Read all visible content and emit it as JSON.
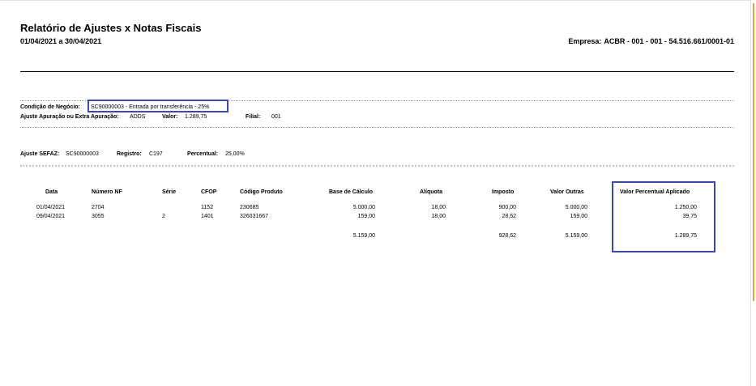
{
  "report": {
    "title": "Relatório de Ajustes x Notas Fiscais",
    "period": "01/04/2021 a 30/04/2021",
    "company_label": "Empresa:",
    "company_value": "ACBR - 001 - 001 - 54.516.661/0001-01"
  },
  "condition": {
    "label": "Condição de Negócio:",
    "value": "SC90000003 - Entrada por transferência -  25%"
  },
  "adjustment": {
    "type_label": "Ajuste Apuração ou Extra Apuração:",
    "type_value": "ADDS",
    "amount_label": "Valor:",
    "amount_value": "1.289,75",
    "branch_label": "Filial:",
    "branch_value": "001"
  },
  "sefaz": {
    "label": "Ajuste SEFAZ:",
    "value": "SC90000003",
    "register_label": "Registro:",
    "register_value": "C197",
    "percent_label": "Percentual:",
    "percent_value": "25,00%"
  },
  "table": {
    "headers": {
      "date": "Data",
      "nf": "Número NF",
      "series": "Série",
      "cfop": "CFOP",
      "product": "Código Produto",
      "base": "Base de Cálculo",
      "rate": "Alíquota",
      "tax": "Imposto",
      "other": "Valor Outras",
      "applied": "Valor Percentual Aplicado"
    },
    "rows": [
      {
        "date": "01/04/2021",
        "nf": "2704",
        "series": "",
        "cfop": "1152",
        "product": "230685",
        "base": "5.000,00",
        "rate": "18,00",
        "tax": "900,00",
        "other": "5.000,00",
        "applied": "1.250,00"
      },
      {
        "date": "09/04/2021",
        "nf": "3055",
        "series": "2",
        "cfop": "1401",
        "product": "326031667",
        "base": "159,00",
        "rate": "18,00",
        "tax": "28,62",
        "other": "159,00",
        "applied": "39,75"
      }
    ],
    "totals": {
      "base": "5.159,00",
      "tax": "928,62",
      "other": "5.159,00",
      "applied": "1.289,75"
    }
  },
  "colors": {
    "highlight_border": "#3d48a8",
    "edge_accent": "#d6a94a"
  }
}
